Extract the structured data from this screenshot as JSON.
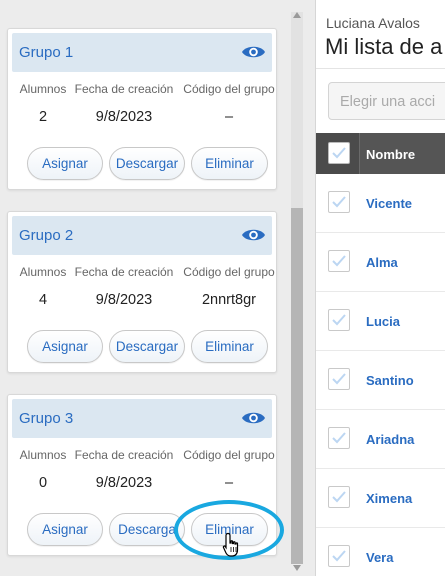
{
  "top_partial_text": "",
  "groups": [
    {
      "title": "Grupo 1",
      "columns": [
        "Alumnos",
        "Fecha de creación",
        "Código del grupo"
      ],
      "students": "2",
      "created": "9/8/2023",
      "code": "–",
      "buttons": {
        "assign": "Asignar",
        "download": "Descargar",
        "delete": "Eliminar"
      }
    },
    {
      "title": "Grupo 2",
      "columns": [
        "Alumnos",
        "Fecha de creación",
        "Código del grupo"
      ],
      "students": "4",
      "created": "9/8/2023",
      "code": "2nnrt8gr",
      "buttons": {
        "assign": "Asignar",
        "download": "Descargar",
        "delete": "Eliminar"
      }
    },
    {
      "title": "Grupo 3",
      "columns": [
        "Alumnos",
        "Fecha de creación",
        "Código del grupo"
      ],
      "students": "0",
      "created": "9/8/2023",
      "code": "–",
      "buttons": {
        "assign": "Asignar",
        "download": "Descarga",
        "delete": "Eliminar"
      }
    }
  ],
  "list_panel": {
    "owner": "Luciana Avalos",
    "title": "Mi lista de a",
    "action_placeholder": "Elegir una acci",
    "column_name": "Nombre",
    "students": [
      {
        "name": "Vicente"
      },
      {
        "name": "Alma"
      },
      {
        "name": "Lucia"
      },
      {
        "name": "Santino"
      },
      {
        "name": "Ariadna"
      },
      {
        "name": "Ximena"
      },
      {
        "name": "Vera"
      }
    ]
  },
  "colors": {
    "accent": "#2a6cc1",
    "header_bg": "#dbe7f1",
    "highlight": "#19a8e0",
    "table_header": "#555555"
  },
  "icons": {
    "view": "eye-icon",
    "cursor": "hand-pointer-icon",
    "checkbox": "checkmark-icon"
  }
}
